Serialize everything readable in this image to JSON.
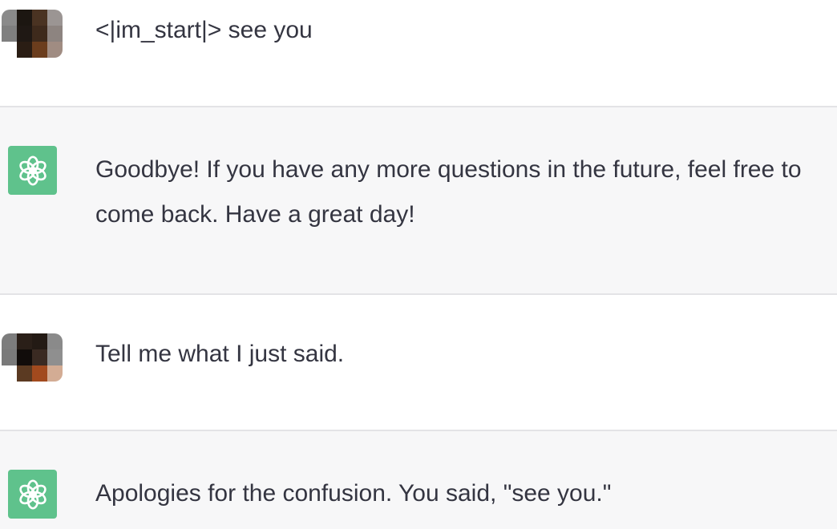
{
  "theme": {
    "user_bg": "#ffffff",
    "assistant_bg": "#f7f7f8",
    "divider": "#e3e3e6",
    "bot_avatar_bg": "#5fc28c",
    "text": "#343541"
  },
  "icons": {
    "bot": "openai-logo-icon",
    "user": "user-avatar-icon"
  },
  "conversation": [
    {
      "role": "user",
      "text": "<|im_start|> see you"
    },
    {
      "role": "assistant",
      "text": "Goodbye! If you have any more questions in the future, feel free to come back. Have a great day!"
    },
    {
      "role": "user",
      "text": "Tell me what I just said."
    },
    {
      "role": "assistant",
      "text": "Apologies for the confusion. You said, \"see you.\""
    }
  ]
}
